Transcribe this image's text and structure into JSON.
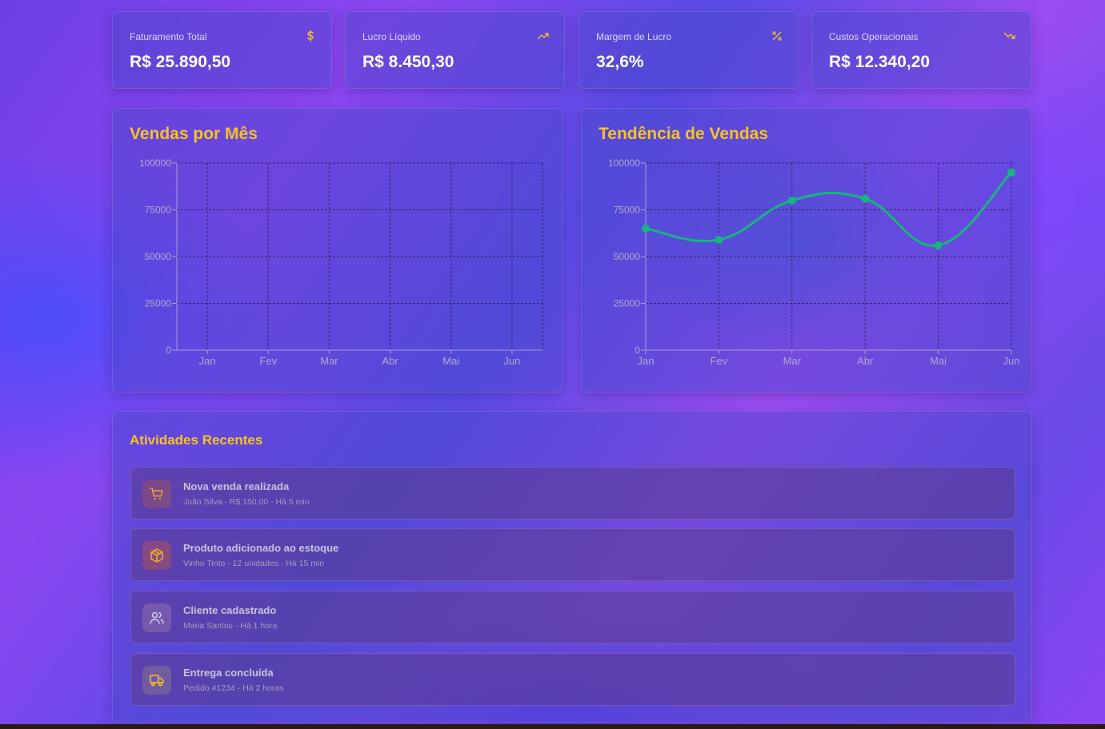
{
  "stats": [
    {
      "label": "Faturamento Total",
      "value": "R$ 25.890,50",
      "icon": "dollar-icon"
    },
    {
      "label": "Lucro Líquido",
      "value": "R$ 8.450,30",
      "icon": "trending-up-icon"
    },
    {
      "label": "Margem de Lucro",
      "value": "32,6%",
      "icon": "percent-icon"
    },
    {
      "label": "Custos Operacionais",
      "value": "R$ 12.340,20",
      "icon": "trending-down-icon"
    }
  ],
  "colors": {
    "accent": "#f6c323",
    "line": "#16b67c"
  },
  "panels": {
    "sales_title": "Vendas por Mês",
    "trend_title": "Tendência de Vendas"
  },
  "chart_data": [
    {
      "type": "bar",
      "title": "Vendas por Mês",
      "categories": [
        "Jan",
        "Fev",
        "Mar",
        "Abr",
        "Mai",
        "Jun"
      ],
      "values": [],
      "yticks": [
        0,
        25000,
        50000,
        75000,
        100000
      ],
      "ylim": [
        0,
        100000
      ],
      "grid": true
    },
    {
      "type": "line",
      "title": "Tendência de Vendas",
      "categories": [
        "Jan",
        "Fev",
        "Mar",
        "Abr",
        "Mai",
        "Jun"
      ],
      "values": [
        65000,
        59000,
        80000,
        81000,
        56000,
        95000
      ],
      "yticks": [
        0,
        25000,
        50000,
        75000,
        100000
      ],
      "ylim": [
        0,
        100000
      ],
      "grid": true
    }
  ],
  "activities": {
    "title": "Atividades Recentes",
    "items": [
      {
        "title": "Nova venda realizada",
        "detail": "João Silva - R$ 150,00 - Há 5 min",
        "icon": "shopping-cart-icon"
      },
      {
        "title": "Produto adicionado ao estoque",
        "detail": "Vinho Tinto - 12 unidades - Há 15 min",
        "icon": "package-icon"
      },
      {
        "title": "Cliente cadastrado",
        "detail": "Maria Santos - Há 1 hora",
        "icon": "users-icon"
      },
      {
        "title": "Entrega concluída",
        "detail": "Pedido #1234 - Há 2 horas",
        "icon": "truck-icon"
      }
    ]
  }
}
